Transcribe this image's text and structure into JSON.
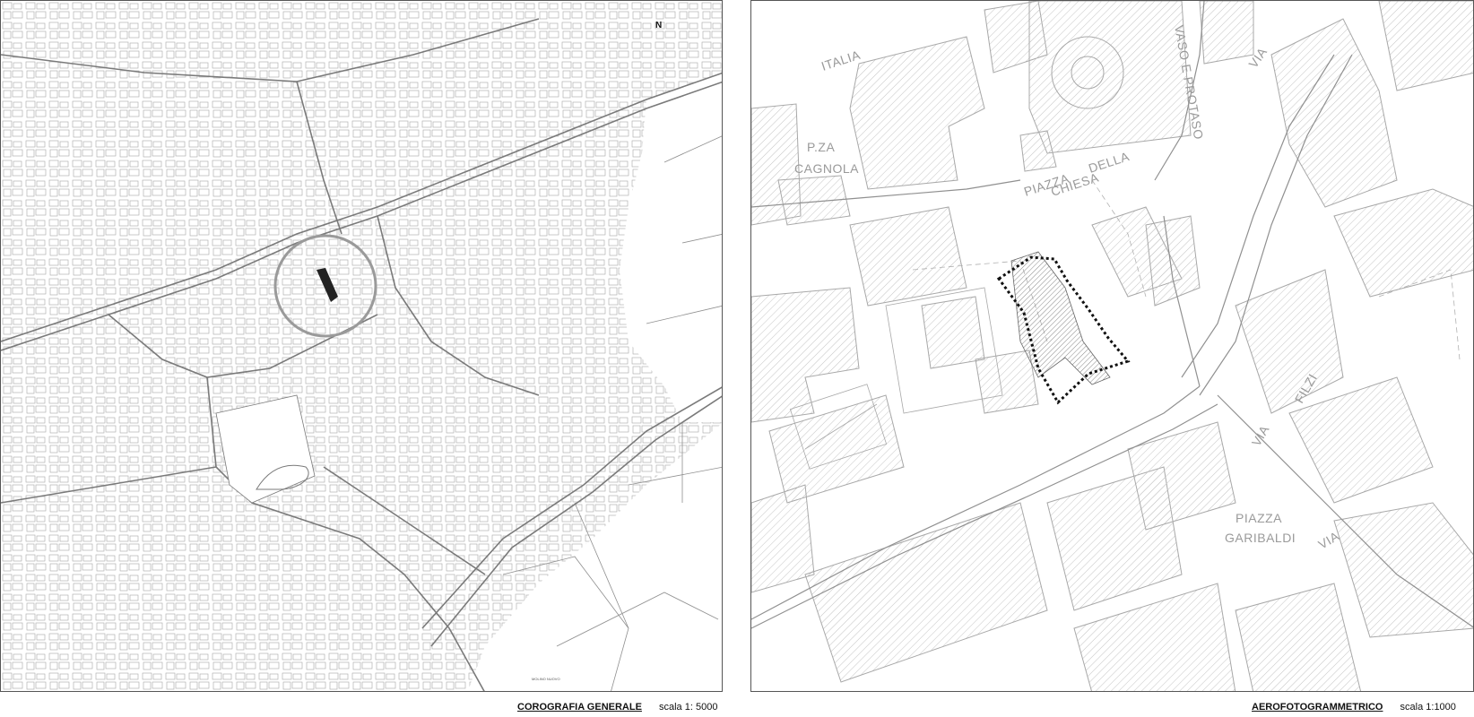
{
  "left_map": {
    "north_label": "N",
    "bottom_tiny_label": "MOLINO NUOVO",
    "caption_title": "COROGRAFIA GENERALE",
    "caption_scale": "scala 1: 5000"
  },
  "right_map": {
    "streets": {
      "italia": "ITALIA",
      "pza": "P.ZA",
      "cagnola": "CAGNOLA",
      "piazza": "PIAZZA",
      "della": "DELLA",
      "chiesa": "CHIESA",
      "vaso_e_protaso": "VASO E PROTASO",
      "via_top": "VIA",
      "filzi": "FILZI",
      "via_mid": "VIA",
      "piazza_g": "PIAZZA",
      "garibaldi": "GARIBALDI",
      "via_bottom": "VIA"
    },
    "caption_title": "AEROFOTOGRAMMETRICO",
    "caption_scale": "scala 1:1000"
  },
  "colors": {
    "line": "#8a8a8a",
    "hatch": "#bdbdbd",
    "highlight": "#111111",
    "circle": "#9a9a9a"
  }
}
